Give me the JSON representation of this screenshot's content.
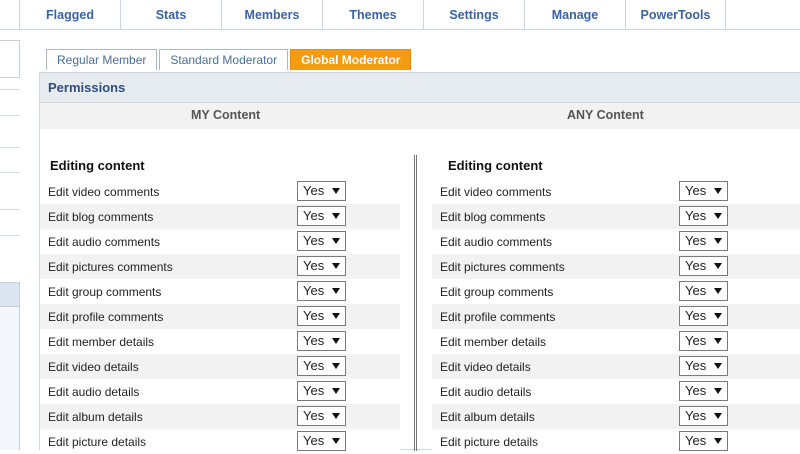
{
  "nav": [
    "Flagged",
    "Stats",
    "Members",
    "Themes",
    "Settings",
    "Manage",
    "PowerTools"
  ],
  "tabs": [
    {
      "label": "Regular Member",
      "active": false
    },
    {
      "label": "Standard Moderator",
      "active": false
    },
    {
      "label": "Global Moderator",
      "active": true
    }
  ],
  "panel": {
    "title": "Permissions",
    "my_header": "MY Content",
    "any_header": "ANY Content",
    "left_section": "Editing content",
    "right_section": "Editing content"
  },
  "permissions": [
    {
      "label": "Edit video comments",
      "value": "Yes"
    },
    {
      "label": "Edit blog comments",
      "value": "Yes"
    },
    {
      "label": "Edit audio comments",
      "value": "Yes"
    },
    {
      "label": "Edit pictures comments",
      "value": "Yes"
    },
    {
      "label": "Edit group comments",
      "value": "Yes"
    },
    {
      "label": "Edit profile comments",
      "value": "Yes"
    },
    {
      "label": "Edit member details",
      "value": "Yes"
    },
    {
      "label": "Edit video details",
      "value": "Yes"
    },
    {
      "label": "Edit audio details",
      "value": "Yes"
    },
    {
      "label": "Edit album details",
      "value": "Yes"
    },
    {
      "label": "Edit picture details",
      "value": "Yes"
    }
  ],
  "colors": {
    "accent_tab": "#f39c12",
    "nav_text": "#3a64a4",
    "panel_header_bg": "#e6ebf0"
  }
}
